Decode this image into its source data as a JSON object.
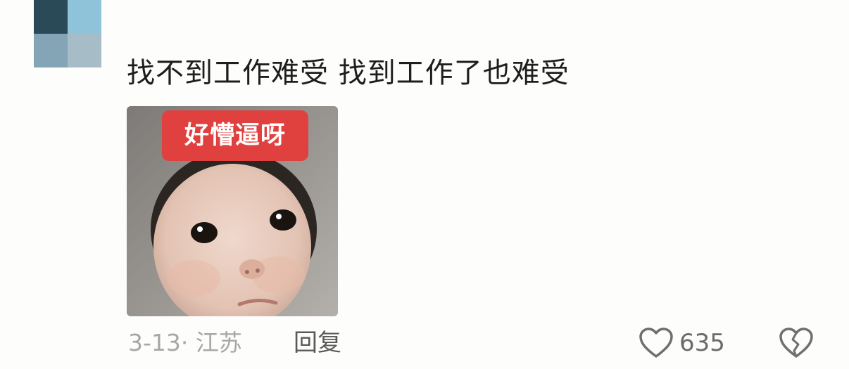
{
  "comment": {
    "text": "找不到工作难受 找到工作了也难受",
    "sticker": {
      "caption": "好懵逼呀",
      "caption_bg": "#e0413f"
    },
    "date_location": "3-13· 江苏",
    "reply_label": "回复",
    "like_count": "635",
    "like_icon": "heart-outline-icon",
    "dislike_icon": "broken-heart-icon"
  }
}
